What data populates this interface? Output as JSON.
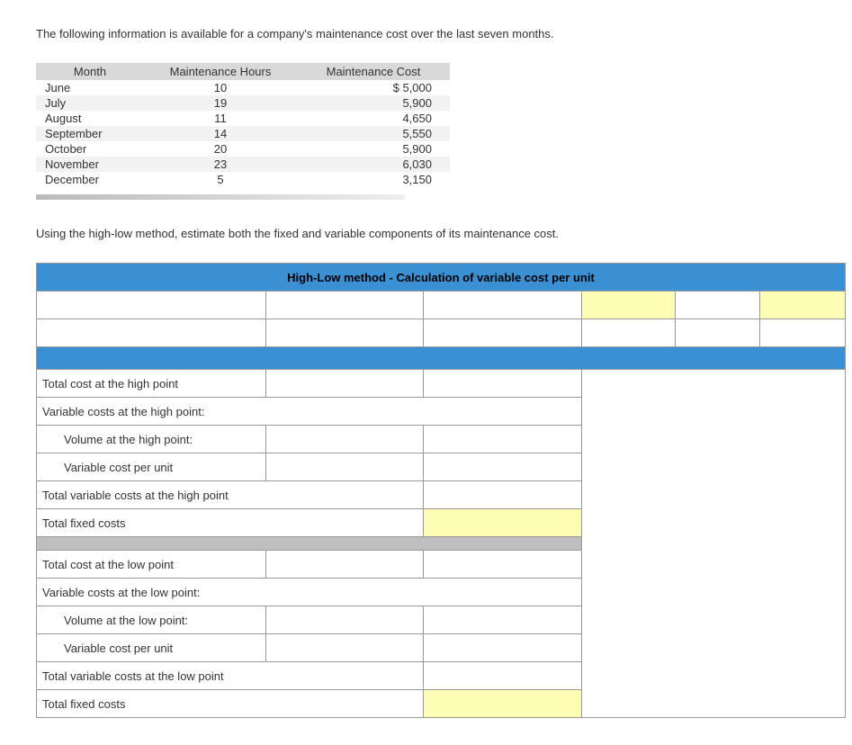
{
  "intro1": "The following information is available for a company's maintenance cost over the last seven months.",
  "intro2": "Using the high-low method, estimate both the fixed and variable components of its maintenance cost.",
  "table": {
    "headers": [
      "Month",
      "Maintenance Hours",
      "Maintenance Cost"
    ],
    "rows": [
      {
        "month": "June",
        "hours": "10",
        "cost": "$  5,000"
      },
      {
        "month": "July",
        "hours": "19",
        "cost": "5,900"
      },
      {
        "month": "August",
        "hours": "11",
        "cost": "4,650"
      },
      {
        "month": "September",
        "hours": "14",
        "cost": "5,550"
      },
      {
        "month": "October",
        "hours": "20",
        "cost": "5,900"
      },
      {
        "month": "November",
        "hours": "23",
        "cost": "6,030"
      },
      {
        "month": "December",
        "hours": "5",
        "cost": "3,150"
      }
    ]
  },
  "worksheet": {
    "title": "High-Low method - Calculation of variable cost per unit",
    "labels": {
      "tc_high": "Total cost at the high point",
      "vc_high": "Variable costs at the high point:",
      "vol_high": "Volume at the high point:",
      "vcpu1": "Variable cost per unit",
      "tvc_high": "Total variable costs at the high point",
      "tfc1": "Total fixed costs",
      "tc_low": "Total cost at the low point",
      "vc_low": "Variable costs at the low point:",
      "vol_low": "Volume at the low point:",
      "vcpu2": "Variable cost per unit",
      "tvc_low": "Total variable costs at the low point",
      "tfc2": "Total fixed costs"
    }
  },
  "chart_data": {
    "type": "table",
    "title": "Maintenance cost by month",
    "columns": [
      "Month",
      "Maintenance Hours",
      "Maintenance Cost"
    ],
    "rows": [
      [
        "June",
        10,
        5000
      ],
      [
        "July",
        19,
        5900
      ],
      [
        "August",
        11,
        4650
      ],
      [
        "September",
        14,
        5550
      ],
      [
        "October",
        20,
        5900
      ],
      [
        "November",
        23,
        6030
      ],
      [
        "December",
        5,
        3150
      ]
    ]
  }
}
